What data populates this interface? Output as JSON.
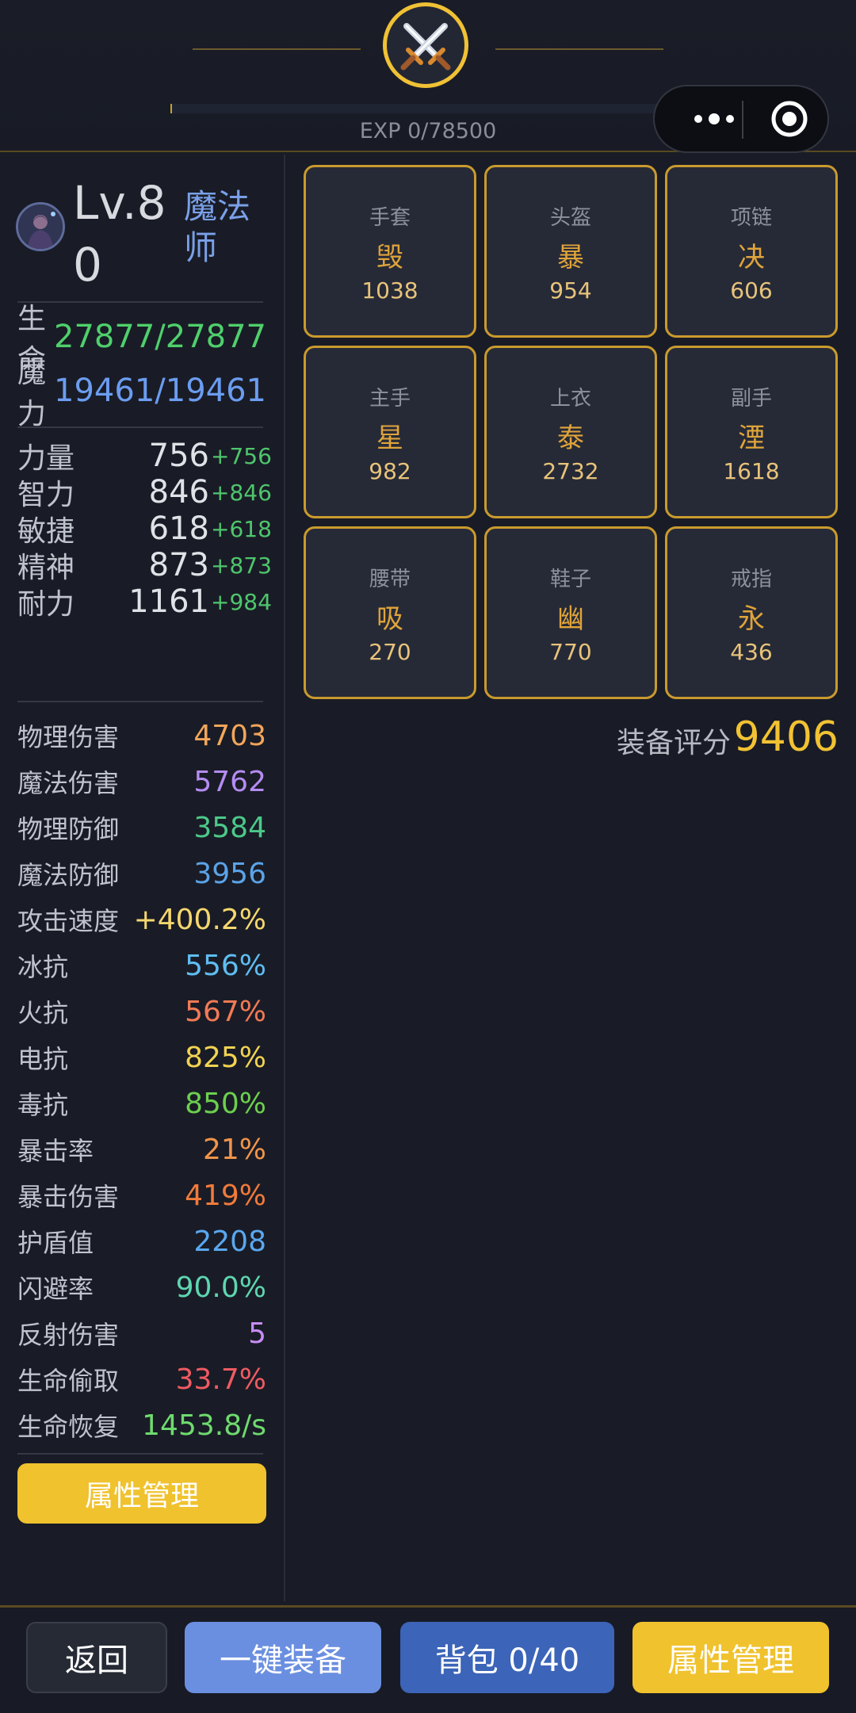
{
  "header": {
    "emblem_icon": "crossed-swords-icon",
    "exp_text": "EXP 0/78500",
    "exp_progress": 0,
    "menu_icon": "more-dots-icon",
    "close_icon": "target-circle-icon"
  },
  "character": {
    "avatar_icon": "mage-avatar-icon",
    "level": "Lv.80",
    "class": "魔法师",
    "hp_label": "生命",
    "hp_value": "27877/27877",
    "mp_label": "魔力",
    "mp_value": "19461/19461"
  },
  "attributes": [
    {
      "label": "力量",
      "value": "756",
      "bonus": "+756"
    },
    {
      "label": "智力",
      "value": "846",
      "bonus": "+846"
    },
    {
      "label": "敏捷",
      "value": "618",
      "bonus": "+618"
    },
    {
      "label": "精神",
      "value": "873",
      "bonus": "+873"
    },
    {
      "label": "耐力",
      "value": "1161",
      "bonus": "+984"
    }
  ],
  "stats": [
    {
      "label": "物理伤害",
      "value": "4703",
      "color": "#f4a65a"
    },
    {
      "label": "魔法伤害",
      "value": "5762",
      "color": "#b58cf3"
    },
    {
      "label": "物理防御",
      "value": "3584",
      "color": "#4cc98a"
    },
    {
      "label": "魔法防御",
      "value": "3956",
      "color": "#5ba3e8"
    },
    {
      "label": "攻击速度",
      "value": "+400.2%",
      "color": "#f5d76e"
    },
    {
      "label": "冰抗",
      "value": "556%",
      "color": "#5fbdf2"
    },
    {
      "label": "火抗",
      "value": "567%",
      "color": "#f27a55"
    },
    {
      "label": "电抗",
      "value": "825%",
      "color": "#f2d352"
    },
    {
      "label": "毒抗",
      "value": "850%",
      "color": "#6ccf4e"
    },
    {
      "label": "暴击率",
      "value": "21%",
      "color": "#f2944a"
    },
    {
      "label": "暴击伤害",
      "value": "419%",
      "color": "#f27a3a"
    },
    {
      "label": "护盾值",
      "value": "2208",
      "color": "#5aa8f0"
    },
    {
      "label": "闪避率",
      "value": "90.0%",
      "color": "#5ed6b0"
    },
    {
      "label": "反射伤害",
      "value": "5",
      "color": "#c88cf5"
    },
    {
      "label": "生命偷取",
      "value": "33.7%",
      "color": "#f05a62"
    },
    {
      "label": "生命恢复",
      "value": "1453.8/s",
      "color": "#6edb6e"
    }
  ],
  "left_button": "属性管理",
  "equipment": [
    {
      "slot": "手套",
      "char": "毁",
      "score": "1038"
    },
    {
      "slot": "头盔",
      "char": "暴",
      "score": "954"
    },
    {
      "slot": "项链",
      "char": "决",
      "score": "606"
    },
    {
      "slot": "主手",
      "char": "星",
      "score": "982"
    },
    {
      "slot": "上衣",
      "char": "泰",
      "score": "2732"
    },
    {
      "slot": "副手",
      "char": "湮",
      "score": "1618"
    },
    {
      "slot": "腰带",
      "char": "吸",
      "score": "270"
    },
    {
      "slot": "鞋子",
      "char": "幽",
      "score": "770"
    },
    {
      "slot": "戒指",
      "char": "永",
      "score": "436"
    }
  ],
  "equip_score": {
    "label": "装备评分",
    "value": "9406"
  },
  "footer": {
    "back": "返回",
    "auto_equip": "一键装备",
    "bag": "背包 0/40",
    "attr_manage": "属性管理"
  },
  "colors": {
    "hp": "#4fd06c",
    "mp": "#6b9cf0",
    "gold": "#f0c22e",
    "slot_border": "#c99a2e"
  }
}
